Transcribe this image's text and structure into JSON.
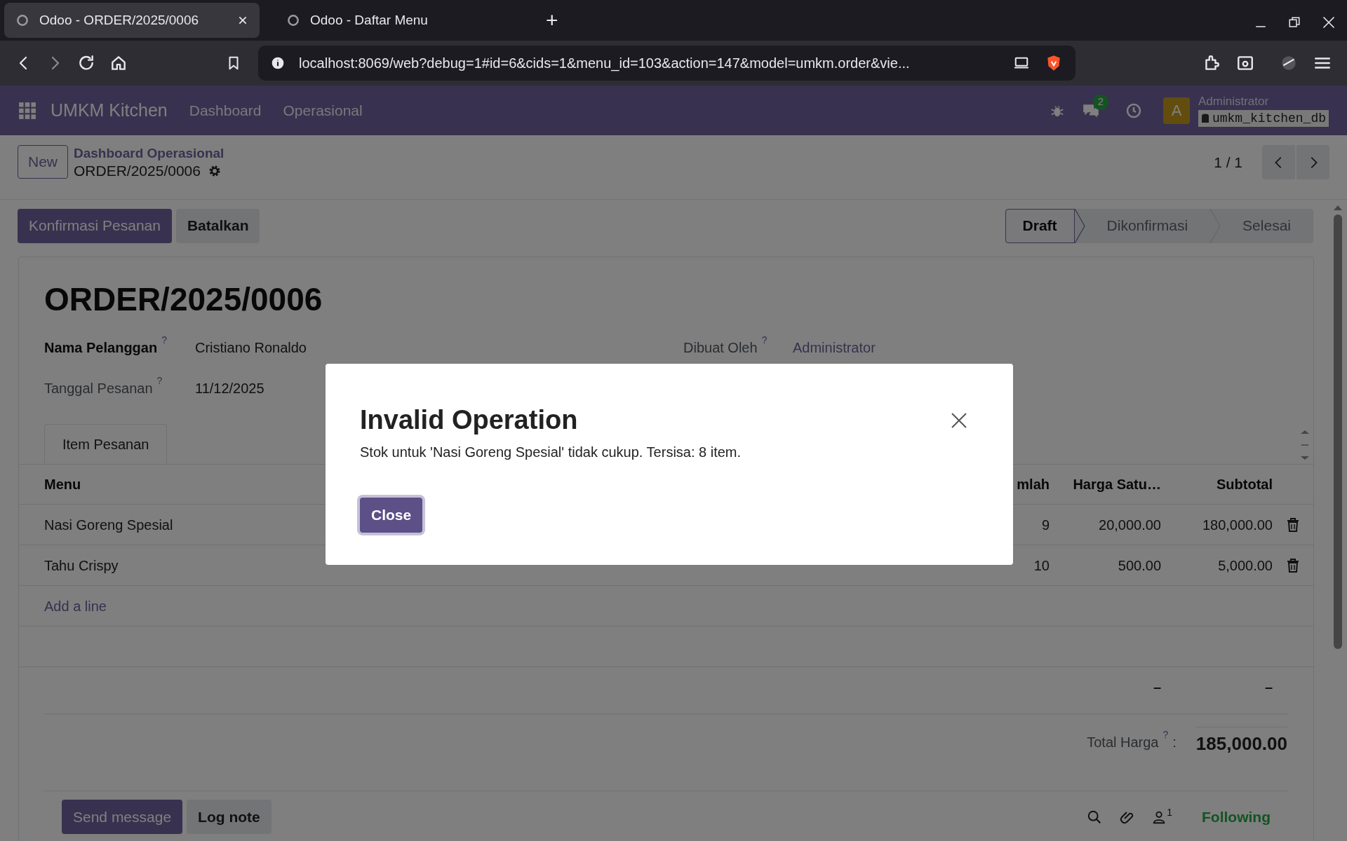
{
  "browser": {
    "tabs": [
      {
        "title": "Odoo - ORDER/2025/0006",
        "selected": true
      },
      {
        "title": "Odoo - Daftar Menu",
        "selected": false
      }
    ],
    "new_tab": "+",
    "url": "localhost:8069/web?debug=1#id=6&cids=1&menu_id=103&action=147&model=umkm.order&vie..."
  },
  "navbar": {
    "app": "UMKM Kitchen",
    "menus": [
      "Dashboard",
      "Operasional"
    ],
    "message_count": "2",
    "avatar_letter": "A",
    "user": "Administrator",
    "database": "umkm_kitchen_db"
  },
  "control_panel": {
    "new_button": "New",
    "breadcrumb": "Dashboard Operasional",
    "record": "ORDER/2025/0006",
    "pager": "1 / 1"
  },
  "actions": [
    {
      "label": "Konfirmasi Pesanan",
      "kind": "primary"
    },
    {
      "label": "Batalkan",
      "kind": "secondary"
    }
  ],
  "status_steps": [
    {
      "label": "Draft",
      "selected": true
    },
    {
      "label": "Dikonfirmasi",
      "selected": false
    },
    {
      "label": "Selesai",
      "selected": false
    }
  ],
  "form": {
    "title": "ORDER/2025/0006",
    "left_fields": [
      {
        "label": "Nama Pelanggan",
        "help": "?",
        "value": "Cristiano Ronaldo",
        "required": true,
        "kind": "text"
      },
      {
        "label": "Tanggal Pesanan",
        "help": "?",
        "value": "11/12/2025",
        "required": false,
        "kind": "text"
      }
    ],
    "right_fields": [
      {
        "label": "Dibuat Oleh",
        "help": "?",
        "value": "Administrator",
        "required": false,
        "kind": "link"
      }
    ]
  },
  "notebook": {
    "tabs": [
      {
        "label": "Item Pesanan",
        "selected": true
      }
    ]
  },
  "lines": {
    "columns": [
      "Menu",
      "mlah",
      "Harga Satu…",
      "Subtotal"
    ],
    "rows": [
      {
        "menu": "Nasi Goreng Spesial",
        "qty": "9",
        "price": "20,000.00",
        "subtotal": "180,000.00"
      },
      {
        "menu": "Tahu Crispy",
        "qty": "10",
        "price": "500.00",
        "subtotal": "5,000.00"
      }
    ],
    "add_line": "Add a line",
    "sums": [
      "–",
      "–"
    ]
  },
  "total": {
    "label": "Total Harga",
    "help": "?",
    "colon": ":",
    "value": "185,000.00"
  },
  "chatter": {
    "buttons": [
      {
        "label": "Send message",
        "kind": "primary"
      },
      {
        "label": "Log note",
        "kind": "secondary"
      }
    ],
    "follower_count": "1",
    "follow_label": "Following"
  },
  "dialog": {
    "title": "Invalid Operation",
    "message": "Stok untuk 'Nasi Goreng Spesial' tidak cukup. Tersisa: 8 item.",
    "button": "Close"
  }
}
